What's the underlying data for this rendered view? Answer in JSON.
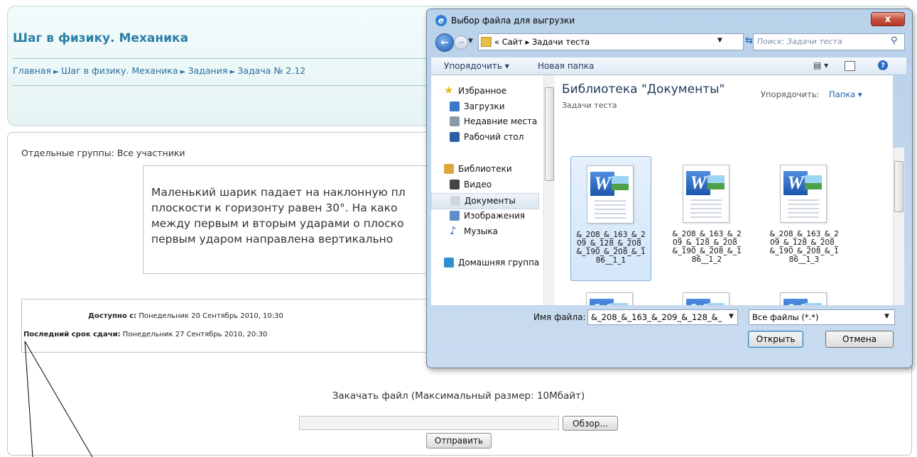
{
  "page": {
    "course_title": "Шаг в физику. Механика",
    "breadcrumb": [
      {
        "label": "Главная"
      },
      {
        "label": "Шаг в физику. Механика"
      },
      {
        "label": "Задания"
      },
      {
        "label": "Задача № 2.12"
      }
    ],
    "breadcrumb_separator": "►",
    "groups_label": "Отдельные группы: Все участники",
    "question_lines": [
      "Маленький шарик падает на наклонную пл",
      "плоскости к горизонту равен 30°. На како",
      "между первым и вторым ударами о плоско",
      "первым ударом направлена вертикально"
    ],
    "available_from_label": "Доступно с:",
    "available_from_value": "Понедельник 20 Сентябрь 2010, 10:30",
    "deadline_label": "Последний срок сдачи:",
    "deadline_value": "Понедельник 27 Сентябрь 2010, 20:30",
    "upload_label": "Закачать файл (Максимальный размер: 10Мбайт)",
    "browse_button": "Обзор...",
    "submit_button": "Отправить"
  },
  "dialog": {
    "title": "Выбор файла для выгрузки",
    "close_glyph": "x",
    "address_prefix": "«",
    "address_path": [
      "Сайт",
      "Задачи теста"
    ],
    "search_placeholder": "Поиск: Задачи теста",
    "toolbar": {
      "organize": "Упорядочить ▾",
      "new_folder": "Новая папка"
    },
    "nav_items": [
      {
        "label": "Избранное",
        "icon": "star-icon",
        "color": "#e8b923",
        "indent": false
      },
      {
        "label": "Загрузки",
        "icon": "downloads-icon",
        "color": "#3a76c9",
        "indent": true
      },
      {
        "label": "Недавние места",
        "icon": "recent-places-icon",
        "color": "#8c9aa8",
        "indent": true
      },
      {
        "label": "Рабочий стол",
        "icon": "desktop-icon",
        "color": "#2d5fa6",
        "indent": true
      },
      {
        "label": "Библиотеки",
        "icon": "libraries-icon",
        "color": "#d9a93a",
        "indent": false
      },
      {
        "label": "Видео",
        "icon": "video-icon",
        "color": "#444444",
        "indent": true
      },
      {
        "label": "Документы",
        "icon": "documents-icon",
        "color": "#cfd6de",
        "indent": true,
        "selected": true
      },
      {
        "label": "Изображения",
        "icon": "pictures-icon",
        "color": "#5b8fc7",
        "indent": true
      },
      {
        "label": "Музыка",
        "icon": "music-icon",
        "color": "#2f6fc4",
        "indent": true
      },
      {
        "label": "Домашняя группа",
        "icon": "homegroup-icon",
        "color": "#2e8fd0",
        "indent": false
      }
    ],
    "library_title": "Библиотека \"Документы\"",
    "library_subtitle": "Задачи теста",
    "arrange_label": "Упорядочить:",
    "arrange_value": "Папка ▾",
    "files": [
      {
        "name": "&_208_&_163_&_209_&_128_&_208_&_190_&_208_&_186__1_1",
        "selected": true
      },
      {
        "name": "&_208_&_163_&_209_&_128_&_208_&_190_&_208_&_186__1_2",
        "selected": false
      },
      {
        "name": "&_208_&_163_&_209_&_128_&_208_&_190_&_208_&_186__1_3",
        "selected": false
      },
      {
        "name": "",
        "selected": false
      },
      {
        "name": "",
        "selected": false
      },
      {
        "name": "",
        "selected": false
      }
    ],
    "file_name_label": "Имя файла:",
    "file_name_value": "&_208_&_163_&_209_&_128_&_",
    "filter_value": "Все файлы (*.*)",
    "open_button": "Открыть",
    "cancel_button": "Отмена"
  },
  "colors": {
    "link": "#2a6fa0",
    "course_title": "#2a7fa8",
    "selection": "#d3e6fa"
  }
}
